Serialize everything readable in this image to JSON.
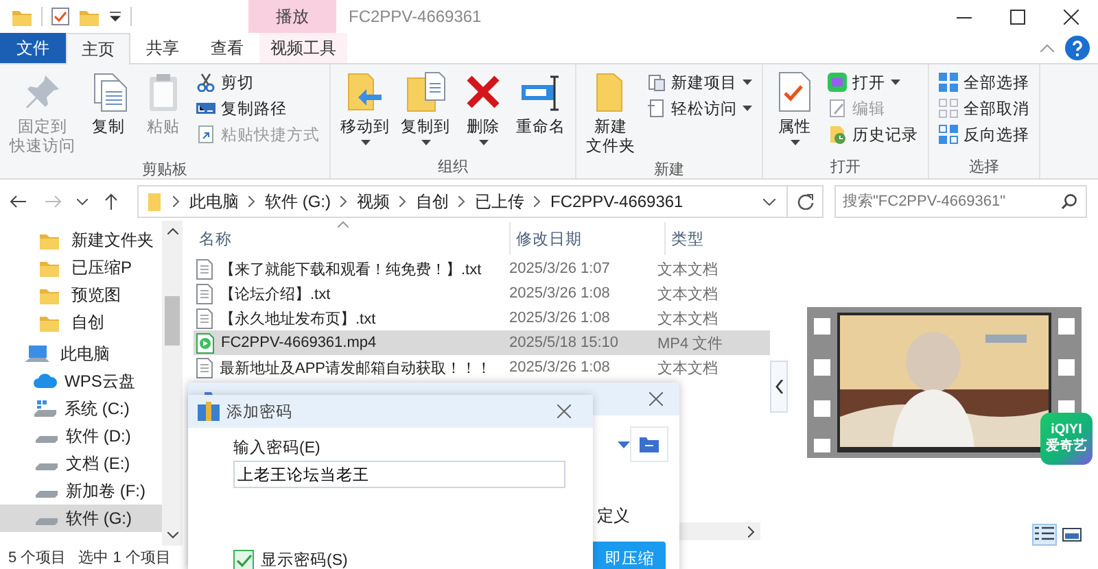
{
  "window": {
    "title": "FC2PPV-4669361"
  },
  "ribbon_tabs": [
    {
      "label": "文件",
      "kind": "file",
      "selected": false
    },
    {
      "label": "主页",
      "kind": "tab",
      "selected": true
    },
    {
      "label": "共享",
      "kind": "tab",
      "selected": false
    },
    {
      "label": "查看",
      "kind": "tab",
      "selected": false
    },
    {
      "label": "视频工具",
      "kind": "context",
      "context_label": "播放",
      "selected": false
    }
  ],
  "ribbon_groups": [
    {
      "label": "剪贴板",
      "large": [
        {
          "label_lines": [
            "固定到",
            "快速访问"
          ],
          "disabled": true,
          "dropdown": false
        },
        {
          "label": "复制",
          "disabled": false,
          "dropdown": false
        },
        {
          "label": "粘贴",
          "disabled": true,
          "dropdown": false
        }
      ],
      "small": [
        {
          "label": "剪切",
          "disabled": false,
          "dropdown": false
        },
        {
          "label": "复制路径",
          "disabled": false,
          "dropdown": false
        },
        {
          "label": "粘贴快捷方式",
          "disabled": true,
          "dropdown": false
        }
      ]
    },
    {
      "label": "组织",
      "large": [
        {
          "label": "移动到",
          "disabled": false,
          "dropdown": true
        },
        {
          "label": "复制到",
          "disabled": false,
          "dropdown": true
        },
        {
          "label": "删除",
          "disabled": false,
          "dropdown": true
        },
        {
          "label": "重命名",
          "disabled": false,
          "dropdown": false
        }
      ]
    },
    {
      "label": "新建",
      "large": [
        {
          "label_lines": [
            "新建",
            "文件夹"
          ],
          "disabled": false,
          "dropdown": false
        }
      ],
      "small": [
        {
          "label": "新建项目",
          "disabled": false,
          "dropdown": true
        },
        {
          "label": "轻松访问",
          "disabled": false,
          "dropdown": true
        }
      ]
    },
    {
      "label": "打开",
      "large": [
        {
          "label": "属性",
          "disabled": false,
          "dropdown": true
        }
      ],
      "small": [
        {
          "label": "打开",
          "disabled": false,
          "dropdown": true
        },
        {
          "label": "编辑",
          "disabled": true,
          "dropdown": false
        },
        {
          "label": "历史记录",
          "disabled": false,
          "dropdown": false
        }
      ]
    },
    {
      "label": "选择",
      "small": [
        {
          "label": "全部选择",
          "disabled": false,
          "dropdown": false
        },
        {
          "label": "全部取消",
          "disabled": false,
          "dropdown": false
        },
        {
          "label": "反向选择",
          "disabled": false,
          "dropdown": false
        }
      ]
    }
  ],
  "address_bar": {
    "breadcrumbs": [
      "此电脑",
      "软件 (G:)",
      "视频",
      "自创",
      "已上传",
      "FC2PPV-4669361"
    ]
  },
  "search": {
    "placeholder": "搜索\"FC2PPV-4669361\""
  },
  "sidebar": {
    "items": [
      {
        "label": "新建文件夹",
        "kind": "folder",
        "selected": false
      },
      {
        "label": "已压缩P",
        "kind": "folder",
        "selected": false
      },
      {
        "label": "预览图",
        "kind": "folder",
        "selected": false
      },
      {
        "label": "自创",
        "kind": "folder",
        "selected": false
      },
      {
        "label": "此电脑",
        "kind": "pc",
        "selected": false
      },
      {
        "label": "WPS云盘",
        "kind": "cloud",
        "selected": false
      },
      {
        "label": "系统 (C:)",
        "kind": "system-drive",
        "selected": false
      },
      {
        "label": "软件 (D:)",
        "kind": "drive",
        "selected": false
      },
      {
        "label": "文档 (E:)",
        "kind": "drive",
        "selected": false
      },
      {
        "label": "新加卷 (F:)",
        "kind": "drive",
        "selected": false
      },
      {
        "label": "软件 (G:)",
        "kind": "drive",
        "selected": true
      }
    ]
  },
  "table": {
    "columns": [
      "名称",
      "修改日期",
      "类型"
    ],
    "rows": [
      {
        "kind": "text",
        "name": "【来了就能下载和观看！纯免费！】.txt",
        "date": "2025/3/26 1:07",
        "type": "文本文档",
        "selected": false
      },
      {
        "kind": "text",
        "name": "【论坛介绍】.txt",
        "date": "2025/3/26 1:08",
        "type": "文本文档",
        "selected": false
      },
      {
        "kind": "text",
        "name": "【永久地址发布页】.txt",
        "date": "2025/3/26 1:08",
        "type": "文本文档",
        "selected": false
      },
      {
        "kind": "video",
        "name": "FC2PPV-4669361.mp4",
        "date": "2025/5/18 15:10",
        "type": "MP4 文件",
        "selected": true
      },
      {
        "kind": "text",
        "name": "最新地址及APP请发邮箱自动获取！！！",
        "date": "2025/3/26 1:08",
        "type": "文本文档",
        "selected": false
      }
    ]
  },
  "preview": {
    "kind": "picture",
    "badge": {
      "line1": "iQIYI",
      "line2": "爱奇艺"
    }
  },
  "status_bar": {
    "item_count": "5 个项目",
    "selection": "选中 1 个项目"
  },
  "back_dialog": {
    "option_label": "定义",
    "primary_button": "即压缩"
  },
  "password_dialog": {
    "title": "添加密码",
    "label": "输入密码(E)",
    "value": "上老王论坛当老王",
    "show_password": {
      "label": "显示密码(S)",
      "checked": true
    }
  }
}
